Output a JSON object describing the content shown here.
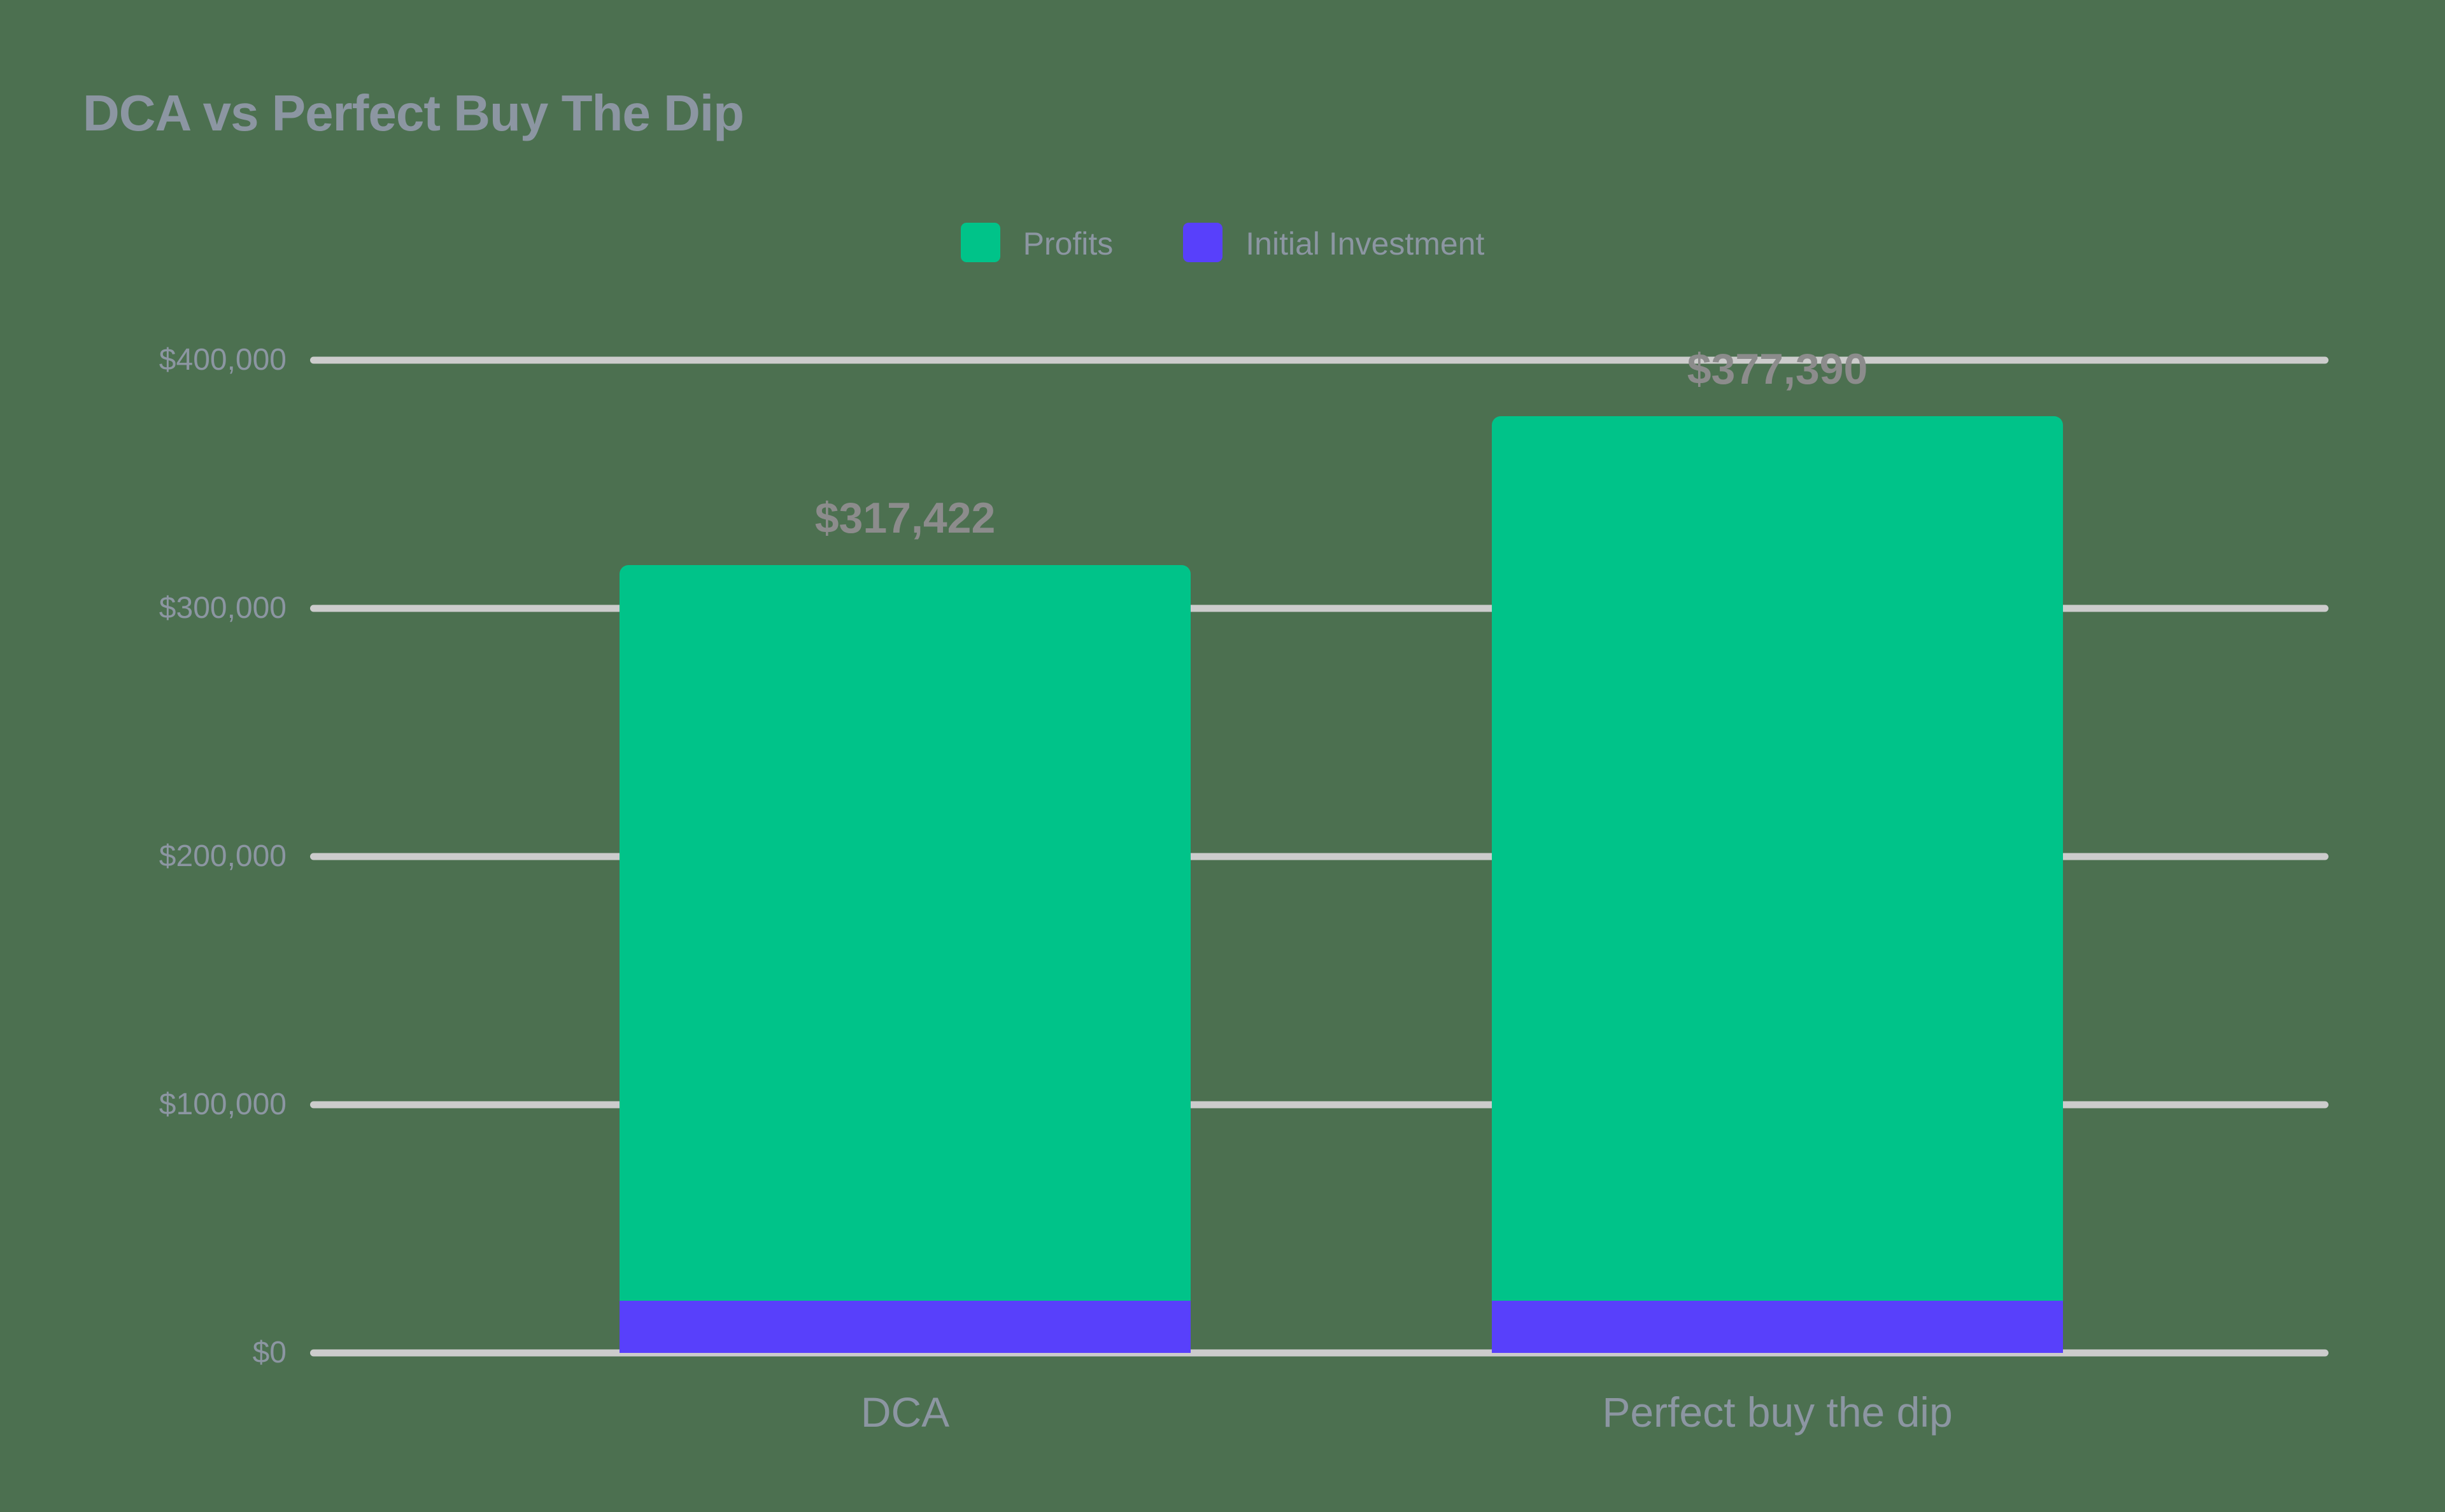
{
  "chart_data": {
    "type": "bar",
    "title": "DCA vs Perfect Buy The Dip",
    "xlabel": "",
    "ylabel": "",
    "stacked": true,
    "grid": true,
    "legend_position": "top-center",
    "categories": [
      "DCA",
      "Perfect buy the dip"
    ],
    "series": [
      {
        "name": "Profits",
        "color": "#00C389",
        "values": [
          296422,
          356390
        ]
      },
      {
        "name": "Initial Investment",
        "color": "#5840FB",
        "values": [
          21000,
          21000
        ]
      }
    ],
    "totals": [
      317422,
      377390
    ],
    "total_labels": [
      "$317,422",
      "$377,390"
    ],
    "ylim": [
      0,
      400000
    ],
    "yticks": [
      400000,
      300000,
      200000,
      100000,
      0
    ],
    "ytick_labels": [
      "$400,000",
      "$300,000",
      "$200,000",
      "$100,000",
      "$0"
    ],
    "colors": {
      "background": "#4C7050",
      "gridline": "#CCCCCC",
      "title_text": "#8C96A2",
      "axis_text": "#8C96A2",
      "value_label_text": "#8C8C8C",
      "profits": "#00C389",
      "initial_investment": "#5840FB"
    }
  },
  "legend": {
    "items": [
      {
        "label": "Profits",
        "color": "#00C389",
        "swatch_name": "legend-swatch-profits"
      },
      {
        "label": "Initial Investment",
        "color": "#5840FB",
        "swatch_name": "legend-swatch-initial-investment"
      }
    ]
  }
}
